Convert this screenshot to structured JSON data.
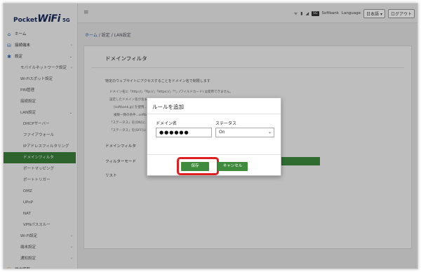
{
  "logo": {
    "brand_prefix": "Pocket",
    "brand_main": "WiFi",
    "version": "5G"
  },
  "sidebar": {
    "items": [
      {
        "label": "ホーム",
        "icon": "home-icon",
        "level": "top"
      },
      {
        "label": "接続端末",
        "icon": "devices-icon",
        "level": "top",
        "chevron": "›"
      },
      {
        "label": "設定",
        "icon": "gear-icon",
        "level": "top",
        "chevron": "⌄"
      },
      {
        "label": "モバイルネットワーク設定",
        "level": "l2",
        "chevron": "‹"
      },
      {
        "label": "Wi-Fiスポット設定",
        "level": "l2"
      },
      {
        "label": "PIN管理",
        "level": "l2"
      },
      {
        "label": "接続設定",
        "level": "l2"
      },
      {
        "label": "LAN設定",
        "level": "l2",
        "chevron": "⌄"
      },
      {
        "label": "DHCPサーバー",
        "level": "l3"
      },
      {
        "label": "ファイアウォール",
        "level": "l3"
      },
      {
        "label": "IPアドレスフィルタリング",
        "level": "l3"
      },
      {
        "label": "ドメインフィルタ",
        "level": "l3",
        "active": true
      },
      {
        "label": "ポートマッピング",
        "level": "l3"
      },
      {
        "label": "ポートトリガー",
        "level": "l3"
      },
      {
        "label": "DMZ",
        "level": "l3"
      },
      {
        "label": "UPnP",
        "level": "l3"
      },
      {
        "label": "NAT",
        "level": "l3"
      },
      {
        "label": "VPNパススルー",
        "level": "l3"
      },
      {
        "label": "Wi-Fi設定",
        "level": "l2",
        "chevron": "‹"
      },
      {
        "label": "端末設定",
        "level": "l2",
        "chevron": "‹"
      },
      {
        "label": "通知設定",
        "level": "l2",
        "chevron": "‹"
      },
      {
        "label": "端末情報",
        "icon": "info-icon",
        "level": "top"
      }
    ]
  },
  "header": {
    "carrier": "Softbank",
    "network_badge": "5G",
    "language_label": "Language",
    "language_value": "日本語",
    "logout": "ログアウト"
  },
  "breadcrumb": {
    "home": "ホーム",
    "rest": " / 設定 / LAN設定"
  },
  "card": {
    "title": "ドメインフィルタ",
    "description": "特定のウェブサイトにアクセスすることをドメイン名で制限します",
    "notes": [
      "ドメイン名に「http://」「ftp://」「https://」「*」(ワイルドカード) は使用できません。",
      "設定したドメイン名が含まれるアドレスへの...",
      "[softbank.jp] を使用...",
      "複数一致の条件...softbank.jp] をフィルタリングすることはできません。",
      "「ステータス」を[ON]に...",
      "「ステータス」を[OFF]に..."
    ],
    "rows": {
      "filter": "ドメインフィルタ",
      "mode": "フィルターモード",
      "list": "リスト"
    }
  },
  "modal": {
    "title": "ルールを追加",
    "domain_label": "ドメイン名",
    "domain_value": "●●●●●●",
    "status_label": "ステータス",
    "status_value": "On",
    "save": "保存",
    "cancel": "キャンセル"
  },
  "colors": {
    "accent": "#3e8b3e",
    "highlight": "#e02020",
    "link": "#2b66b8"
  }
}
